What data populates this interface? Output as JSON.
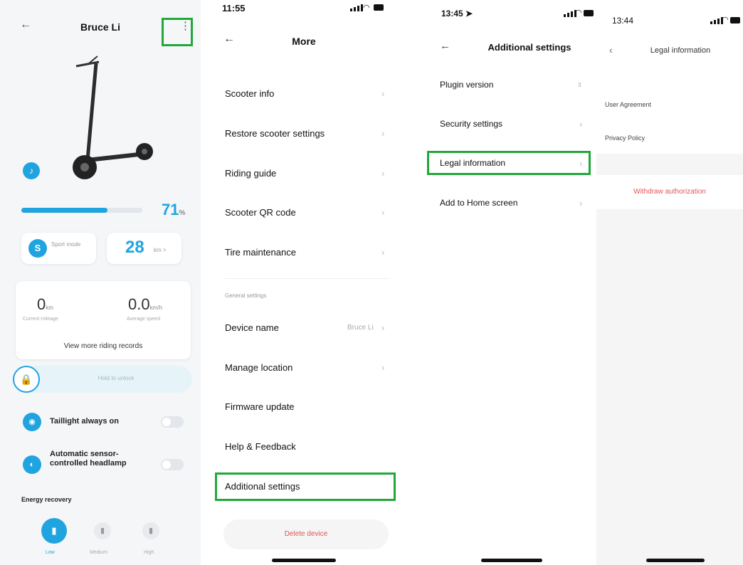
{
  "colors": {
    "accent": "#20a4e0",
    "highlight": "#22a83a",
    "danger": "#e25555"
  },
  "panel1": {
    "back_icon": "arrow-left-icon",
    "title": "Bruce Li",
    "more_icon": "kebab-menu-icon",
    "battery_level": 0.71,
    "battery_value": "71",
    "battery_unit": "%",
    "mode_letter": "S",
    "mode_label": "Sport mode",
    "speed_value": "28",
    "speed_unit": "km >",
    "mileage_value": "0",
    "mileage_unit": "km",
    "mileage_label": "Current mileage",
    "avg_speed_value": "0.0",
    "avg_speed_unit": "km/h",
    "avg_speed_label": "Average speed",
    "view_more": "View more riding records",
    "unlock_label": "Hold to unlock",
    "taillight_label": "Taillight always on",
    "headlamp_label": "Automatic sensor-controlled headlamp",
    "energy_title": "Energy recovery",
    "energy_options": [
      "Low",
      "Medium",
      "High"
    ]
  },
  "panel2": {
    "time": "11:55",
    "title": "More",
    "items": [
      "Scooter info",
      "Restore scooter settings",
      "Riding guide",
      "Scooter QR code",
      "Tire maintenance"
    ],
    "section_label": "General settings",
    "device_name_label": "Device name",
    "device_name_value": "Bruce Li",
    "general_items": [
      "Manage location",
      "Firmware update",
      "Help & Feedback",
      "Additional settings"
    ],
    "delete_label": "Delete device"
  },
  "panel3": {
    "time": "13:45",
    "title": "Additional settings",
    "plugin_label": "Plugin version",
    "plugin_value": "3",
    "items": [
      "Security settings",
      "Legal information",
      "Add to Home screen"
    ]
  },
  "panel4": {
    "time": "13:44",
    "title": "Legal information",
    "items": [
      "User Agreement",
      "Privacy Policy"
    ],
    "withdraw_label": "Withdraw authorization"
  }
}
